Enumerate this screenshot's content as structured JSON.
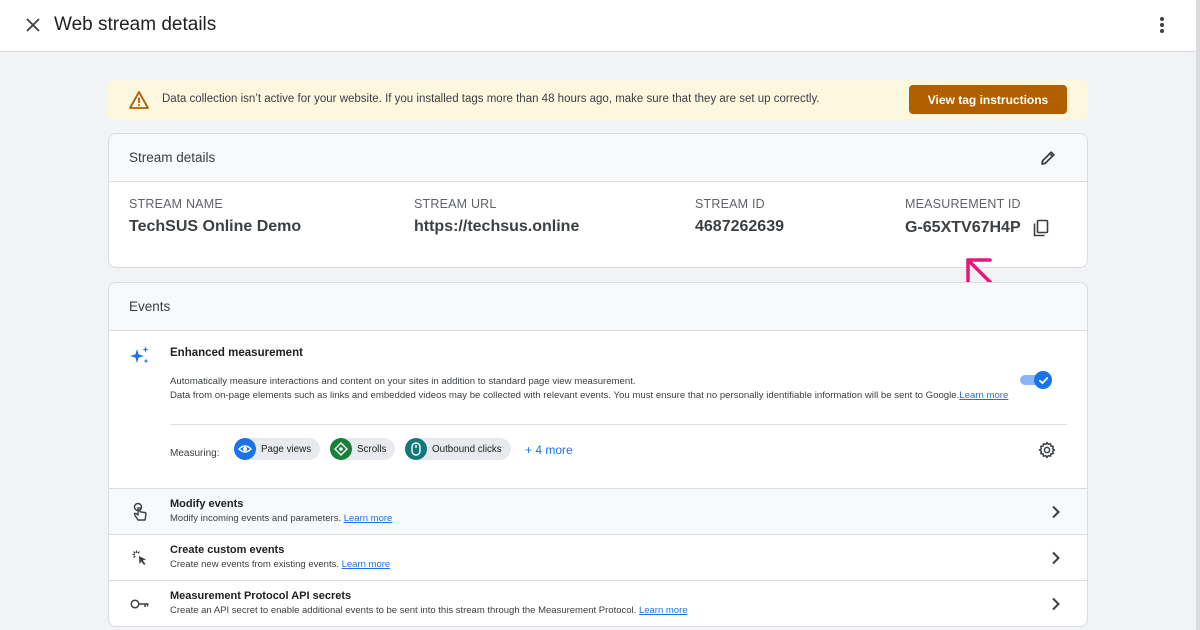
{
  "header": {
    "title": "Web stream details"
  },
  "banner": {
    "message": "Data collection isn’t active for your website. If you installed tags more than 48 hours ago, make sure that they are set up correctly.",
    "button_label": "View tag instructions"
  },
  "stream_details": {
    "title": "Stream details",
    "fields": [
      {
        "label": "STREAM NAME",
        "value": "TechSUS Online Demo"
      },
      {
        "label": "STREAM URL",
        "value": "https://techsus.online"
      },
      {
        "label": "STREAM ID",
        "value": "4687262639"
      },
      {
        "label": "MEASUREMENT ID",
        "value": "G-65XTV67H4P"
      }
    ]
  },
  "events": {
    "title": "Events",
    "enhanced": {
      "title": "Enhanced measurement",
      "line1": "Automatically measure interactions and content on your sites in addition to standard page view measurement.",
      "line2": "Data from on-page elements such as links and embedded videos may be collected with relevant events. You must ensure that no personally identifiable information will be sent to Google.",
      "learn_more": "Learn more",
      "enabled": true,
      "measuring_label": "Measuring:",
      "chips": [
        {
          "label": "Page views",
          "icon": "eye-icon",
          "color": "#1a73e8"
        },
        {
          "label": "Scrolls",
          "icon": "scroll-icon",
          "color": "#188038"
        },
        {
          "label": "Outbound clicks",
          "icon": "mouse-icon",
          "color": "#12787b"
        }
      ],
      "more_label": "+ 4 more"
    },
    "rows": [
      {
        "title": "Modify events",
        "subtitle": "Modify incoming events and parameters.",
        "link": "Learn more",
        "icon": "touch-icon"
      },
      {
        "title": "Create custom events",
        "subtitle": "Create new events from existing events.",
        "link": "Learn more",
        "icon": "cursor-click-icon"
      },
      {
        "title": "Measurement Protocol API secrets",
        "subtitle": "Create an API secret to enable additional events to be sent into this stream through the Measurement Protocol.",
        "link": "Learn more",
        "icon": "key-icon"
      }
    ]
  },
  "colors": {
    "accent": "#1a73e8",
    "warning_button": "#b06000",
    "banner_bg": "#fef7e0",
    "annotation": "#e8177a"
  }
}
